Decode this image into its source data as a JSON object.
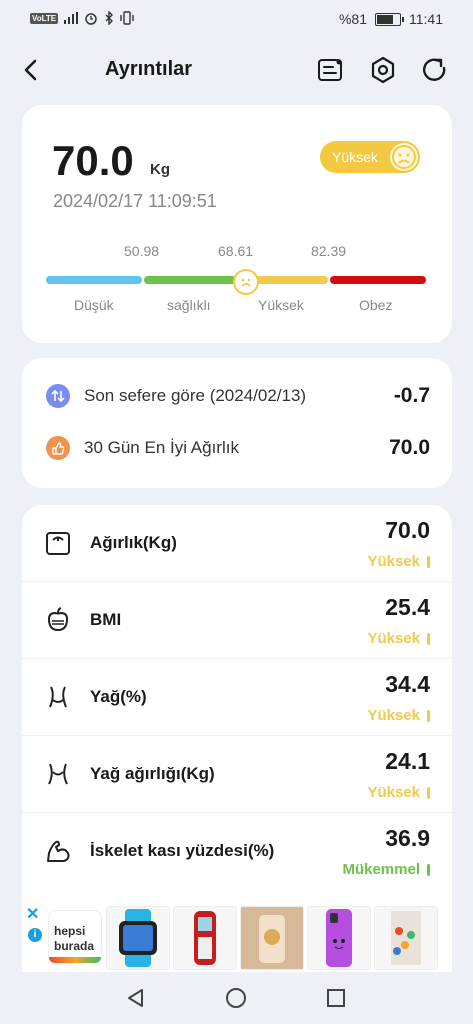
{
  "status_bar": {
    "network": "VoLTE",
    "battery_text": "%81",
    "battery_level": 0.81,
    "time": "11:41"
  },
  "header": {
    "title": "Ayrıntılar",
    "back_icon": "back-arrow-icon",
    "icons": [
      "report-icon",
      "settings-hex-icon",
      "refresh-icon"
    ]
  },
  "summary": {
    "weight": "70.0",
    "unit": "Kg",
    "datetime": "2024/02/17 11:09:51",
    "badge": "Yüksek",
    "scale_values": [
      "50.98",
      "68.61",
      "82.39"
    ],
    "scale_labels": [
      "Düşük",
      "sağlıklı",
      "Yüksek",
      "Obez"
    ],
    "scale_colors": [
      "#5ec3ee",
      "#6cc24a",
      "#f2c94c",
      "#d40c0c"
    ]
  },
  "compare": {
    "rows": [
      {
        "label": "Son sefere göre (2024/02/13)",
        "value": "-0.7",
        "icon": "compare-arrows-icon",
        "color": "#7b8cf0"
      },
      {
        "label": "30 Gün En İyi Ağırlık",
        "value": "70.0",
        "icon": "thumbs-up-icon",
        "color": "#f5914e"
      }
    ]
  },
  "metrics": [
    {
      "label": "Ağırlık(Kg)",
      "value": "70.0",
      "status": "Yüksek",
      "status_color": "#f2c94c",
      "icon": "scale-icon"
    },
    {
      "label": "BMI",
      "value": "25.4",
      "status": "Yüksek",
      "status_color": "#f2c94c",
      "icon": "bmi-icon"
    },
    {
      "label": "Yağ(%)",
      "value": "34.4",
      "status": "Yüksek",
      "status_color": "#f2c94c",
      "icon": "body-fat-icon"
    },
    {
      "label": "Yağ ağırlığı(Kg)",
      "value": "24.1",
      "status": "Yüksek",
      "status_color": "#f2c94c",
      "icon": "fat-weight-icon"
    },
    {
      "label": "İskelet kası yüzdesi(%)",
      "value": "36.9",
      "status": "Mükemmel",
      "status_color": "#6cc24a",
      "icon": "muscle-icon"
    }
  ],
  "ad": {
    "brand_line1": "hepsi",
    "brand_line2": "burada",
    "close": "✕",
    "info": "i"
  },
  "nav": {
    "icons": [
      "back-triangle-icon",
      "home-circle-icon",
      "recents-square-icon"
    ]
  }
}
